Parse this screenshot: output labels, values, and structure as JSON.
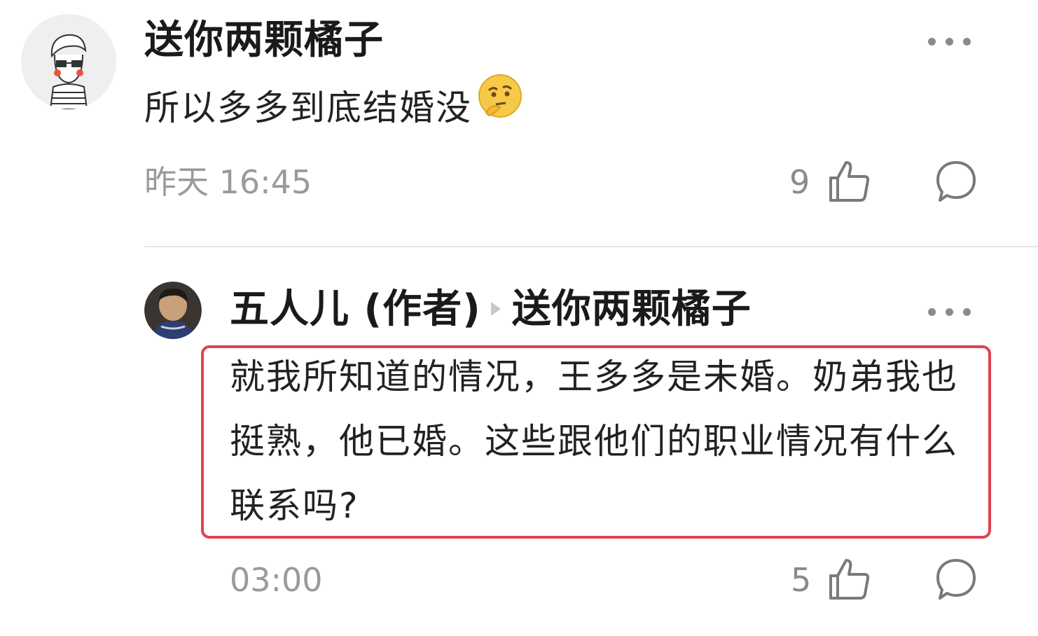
{
  "comments": [
    {
      "author": "送你两颗橘子",
      "text": "所以多多到底结婚没",
      "emoji": "thinking-face",
      "time": "昨天 16:45",
      "likes": "9"
    },
    {
      "author": "五人儿 (作者)",
      "reply_to": "送你两颗橘子",
      "text": "就我所知道的情况，王多多是未婚。奶弟我也挺熟，他已婚。这些跟他们的职业情况有什么联系吗?",
      "time": "03:00",
      "likes": "5"
    }
  ],
  "colors": {
    "highlight": "#e0424f",
    "secondary_text": "#9a9a9a"
  },
  "icons": [
    "avatar",
    "more-icon",
    "thumbs-up-icon",
    "comment-bubble-icon",
    "reply-arrow-icon",
    "thinking-face-emoji"
  ]
}
